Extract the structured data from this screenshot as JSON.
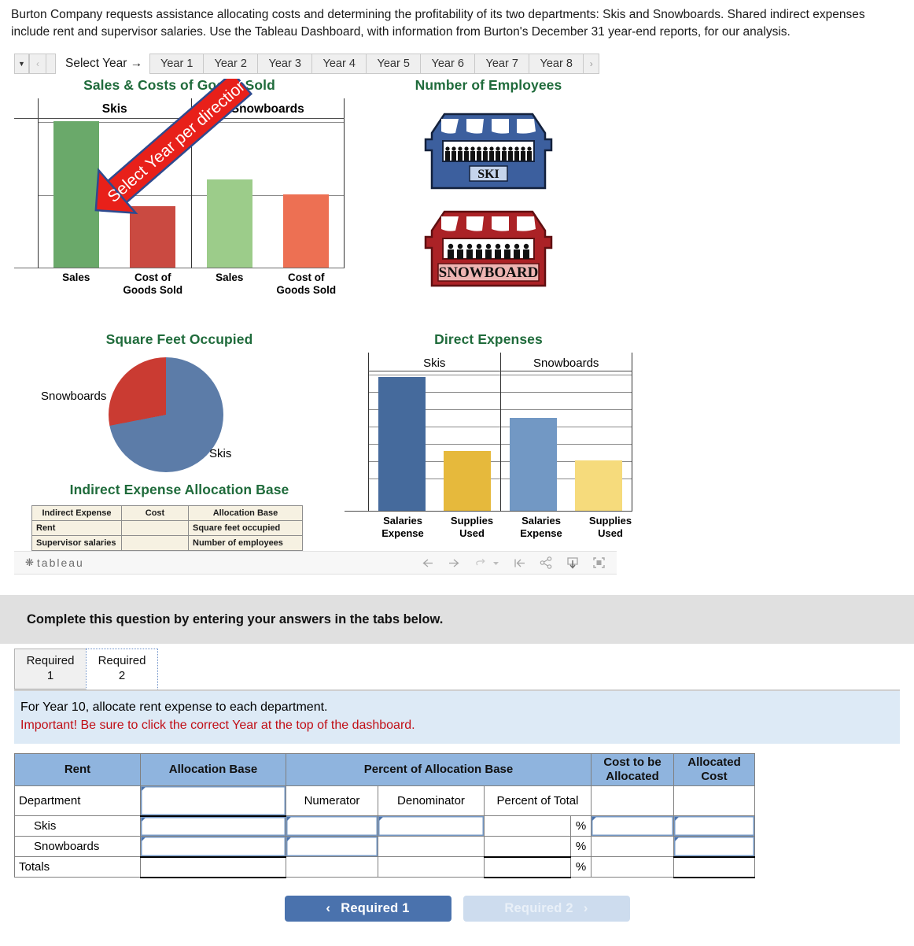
{
  "intro": "Burton Company requests assistance allocating costs and determining the profitability of its two departments: Skis and Snowboards. Shared indirect expenses include rent and supervisor salaries. Use the Tableau Dashboard, with information from Burton's December 31 year-end reports, for our analysis.",
  "year_selector": {
    "dropdown_icon": "caret-down-icon",
    "prev_icon": "chevron-left-icon",
    "next_icon": "chevron-right-icon",
    "label": "Select Year →",
    "years": [
      "Year 1",
      "Year 2",
      "Year 3",
      "Year 4",
      "Year 5",
      "Year 6",
      "Year 7",
      "Year 8"
    ]
  },
  "callout": {
    "text": "Select Year per directions",
    "fill": "#e8201a",
    "stroke": "#2e4a8f"
  },
  "dashboard": {
    "accent_title_color": "#1f6b3b",
    "sales_cogs": {
      "title": "Sales & Costs of Goods Sold",
      "groups": [
        "Skis",
        "Snowboards"
      ],
      "measures": [
        "Sales",
        "Cost of Goods Sold"
      ]
    },
    "employees": {
      "title": "Number of Employees",
      "shops": [
        {
          "name": "SKI",
          "color": "#3c5f9e",
          "sign_bg": "#c5d4ec",
          "people": 16
        },
        {
          "name": "SNOWBOARD",
          "color": "#ab2226",
          "sign_bg": "#edb4b2",
          "people": 11
        }
      ]
    },
    "square_feet": {
      "title": "Square Feet Occupied",
      "labels": [
        "Snowboards",
        "Skis"
      ]
    },
    "indirect_table": {
      "title": "Indirect Expense Allocation Base",
      "headers": [
        "Indirect Expense",
        "Cost",
        "Allocation Base"
      ],
      "rows": [
        [
          "Rent",
          "",
          "Square feet occupied"
        ],
        [
          "Supervisor salaries",
          "",
          "Number of employees"
        ]
      ]
    },
    "direct_expenses": {
      "title": "Direct Expenses",
      "groups": [
        "Skis",
        "Snowboards"
      ],
      "measures": [
        "Salaries Expense",
        "Supplies Used"
      ]
    },
    "toolbar": {
      "logo": "tableau",
      "icons": [
        "back-icon",
        "forward-icon",
        "revert-icon",
        "revert-dropdown-icon",
        "reset-icon",
        "share-icon",
        "download-icon",
        "fullscreen-icon"
      ]
    }
  },
  "chart_data": [
    {
      "type": "bar",
      "title": "Sales & Costs of Goods Sold",
      "categories": [
        "Skis - Sales",
        "Skis - Cost of Goods Sold",
        "Snowboards - Sales",
        "Snowboards - Cost of Goods Sold"
      ],
      "values": [
        100,
        42,
        60,
        50
      ],
      "colors": [
        "#6aa96a",
        "#ca4a41",
        "#9ccc8a",
        "#ed7053"
      ],
      "xlabel": "",
      "ylabel": "",
      "ylim": [
        0,
        105
      ],
      "grid": true,
      "legend": "none"
    },
    {
      "type": "pie",
      "title": "Square Feet Occupied",
      "categories": [
        "Skis",
        "Snowboards"
      ],
      "values": [
        72,
        28
      ],
      "colors": [
        "#5c7ca8",
        "#ca3b32"
      ],
      "legend": "labels-outside"
    },
    {
      "type": "bar",
      "title": "Direct Expenses",
      "categories": [
        "Skis - Salaries Expense",
        "Skis - Supplies Used",
        "Snowboards - Salaries Expense",
        "Snowboards - Supplies Used"
      ],
      "values": [
        100,
        44,
        68,
        37
      ],
      "colors": [
        "#456a9c",
        "#e6b93c",
        "#7298c4",
        "#f6db7c"
      ],
      "xlabel": "",
      "ylabel": "",
      "ylim": [
        0,
        105
      ],
      "grid": true,
      "legend": "none"
    }
  ],
  "question": {
    "banner": "Complete this question by entering your answers in the tabs below.",
    "tabs": [
      {
        "label_line1": "Required",
        "label_line2": "1",
        "active": false
      },
      {
        "label_line1": "Required",
        "label_line2": "2",
        "active": true
      }
    ],
    "prompt_line1": "For Year 10, allocate rent expense to each department.",
    "prompt_line2": "Important! Be sure to click the correct Year at the top of the dashboard.",
    "table": {
      "headers": {
        "col1": "Rent",
        "col2": "Allocation Base",
        "col3": "Percent of Allocation Base",
        "col4": "Cost to be Allocated",
        "col5": "Allocated Cost"
      },
      "subheaders": {
        "dept": "Department",
        "numerator": "Numerator",
        "denominator": "Denominator",
        "percent_of_total": "Percent of Total"
      },
      "rows": [
        {
          "label": "Skis",
          "percent_suffix": "%"
        },
        {
          "label": "Snowboards",
          "percent_suffix": "%"
        },
        {
          "label": "Totals",
          "percent_suffix": "%"
        }
      ]
    },
    "nav": {
      "prev_label": "Required 1",
      "next_label": "Required 2",
      "prev_icon": "chevron-left-icon",
      "next_icon": "chevron-right-icon"
    }
  }
}
